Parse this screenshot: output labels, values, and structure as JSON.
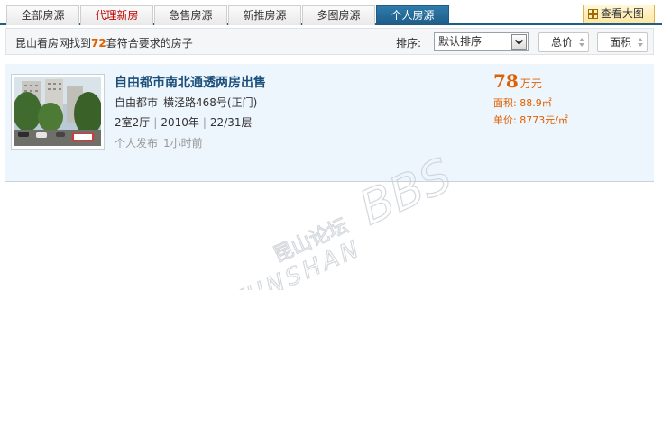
{
  "tabs": [
    {
      "label": "全部房源"
    },
    {
      "label": "代理新房"
    },
    {
      "label": "急售房源"
    },
    {
      "label": "新推房源"
    },
    {
      "label": "多图房源"
    },
    {
      "label": "个人房源"
    }
  ],
  "big_view_label": "查看大图",
  "filter": {
    "summary_prefix": "昆山看房网找到",
    "count": "72",
    "summary_suffix": "套符合要求的房子",
    "sort_label": "排序:",
    "sort_value": "默认排序",
    "price_chip": "总价",
    "area_chip": "面积"
  },
  "listing": {
    "title": "自由都市南北通透两房出售",
    "community": "自由都市",
    "road": "横泾路468号(正门)",
    "layout": "2室2厅",
    "year": "2010年",
    "floor": "22/31层",
    "publisher": "个人发布",
    "time": "1小时前",
    "price": "78",
    "price_unit": "万元",
    "area": "面积: 88.9㎡",
    "unit_price": "单价: 8773元/㎡"
  },
  "colors": {
    "accent": "#1f5f86",
    "price": "#e06000",
    "title": "#1a4f7a"
  }
}
